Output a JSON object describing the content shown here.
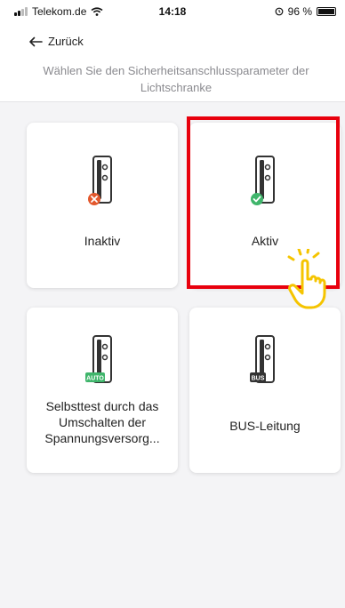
{
  "status": {
    "carrier": "Telekom.de",
    "time": "14:18",
    "battery": "96 %"
  },
  "header": {
    "back_label": "Zurück",
    "subtitle": "Wählen Sie den Sicherheitsanschlussparameter der Lichtschranke"
  },
  "options": [
    {
      "label": "Inaktiv",
      "badge": "x",
      "icon": "light-barrier-inactive-icon"
    },
    {
      "label": "Aktiv",
      "badge": "check",
      "icon": "light-barrier-active-icon"
    },
    {
      "label_lines": [
        "Selbsttest durch das",
        "Umschalten der",
        "Spannungsversorg..."
      ],
      "badge": "AUTO",
      "icon": "light-barrier-auto-icon"
    },
    {
      "label": "BUS-Leitung",
      "badge": "BUS",
      "icon": "light-barrier-bus-icon"
    }
  ],
  "colors": {
    "error": "#e3582d",
    "success": "#3fb56b",
    "auto": "#3fb56b",
    "bus": "#333333",
    "highlight": "#e8000d",
    "hand": "#f5c400"
  }
}
